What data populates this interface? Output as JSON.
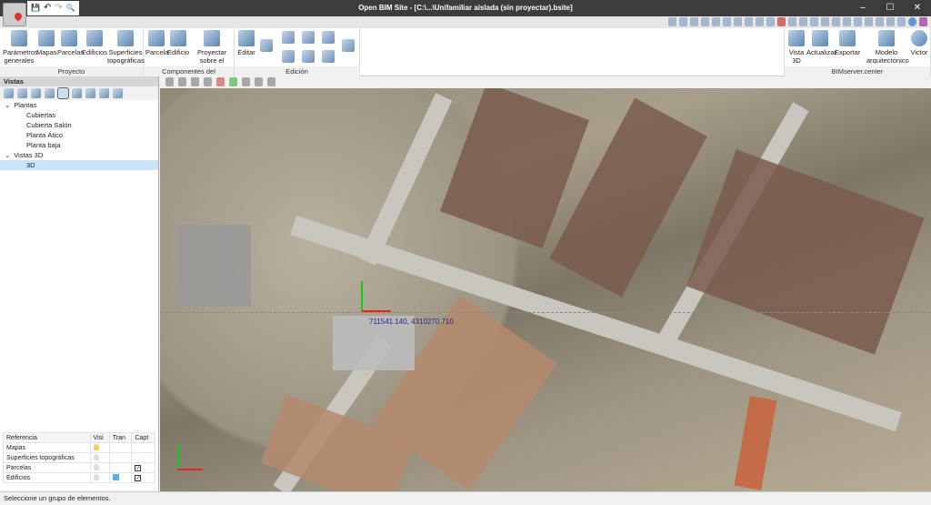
{
  "title": "Open BIM Site - [C:\\...\\Unifamiliar aislada (sin proyectar).bsite]",
  "window_controls": {
    "minimize": "–",
    "maximize": "☐",
    "close": "✕"
  },
  "qat": {
    "save": "💾",
    "undo": "↶",
    "redo": "↷",
    "search": "🔍"
  },
  "ribbon": {
    "proyecto": {
      "label": "Proyecto",
      "buttons": [
        "Parámetros generales",
        "Mapas",
        "Parcelas",
        "Edificios",
        "Superficies topográficas"
      ]
    },
    "componentes": {
      "label": "Componentes del emplazamiento",
      "buttons": [
        "Parcela",
        "Edificio",
        "Proyectar sobre el terreno"
      ]
    },
    "edicion": {
      "label": "Edición",
      "buttons": [
        "Editar"
      ]
    },
    "bimserver": {
      "label": "BIMserver.center",
      "buttons": [
        "Vista 3D",
        "Actualizar",
        "Exportar",
        "Modelo arquitectónico",
        "Victor"
      ]
    }
  },
  "vistas": {
    "header": "Vistas",
    "tree": [
      {
        "label": "Plantas",
        "children": [
          "Cubiertas",
          "Cubierta Salón",
          "Planta Ático",
          "Planta baja"
        ]
      },
      {
        "label": "Vistas 3D",
        "children": [
          "3D"
        ]
      }
    ]
  },
  "reference_table": {
    "headers": [
      "Referencia",
      "Visi",
      "Tran",
      "Capt"
    ],
    "rows": [
      {
        "name": "Mapas",
        "visible": true,
        "transparent": false,
        "capture": false
      },
      {
        "name": "Superficies topográficas",
        "visible": false,
        "transparent": false,
        "capture": false
      },
      {
        "name": "Parcelas",
        "visible": false,
        "transparent": false,
        "capture": true
      },
      {
        "name": "Edificios",
        "visible": false,
        "transparent": true,
        "capture": true
      }
    ]
  },
  "map": {
    "coordinate": "711541.140, 4310270.710"
  },
  "status": "Seleccione un grupo de elementos."
}
